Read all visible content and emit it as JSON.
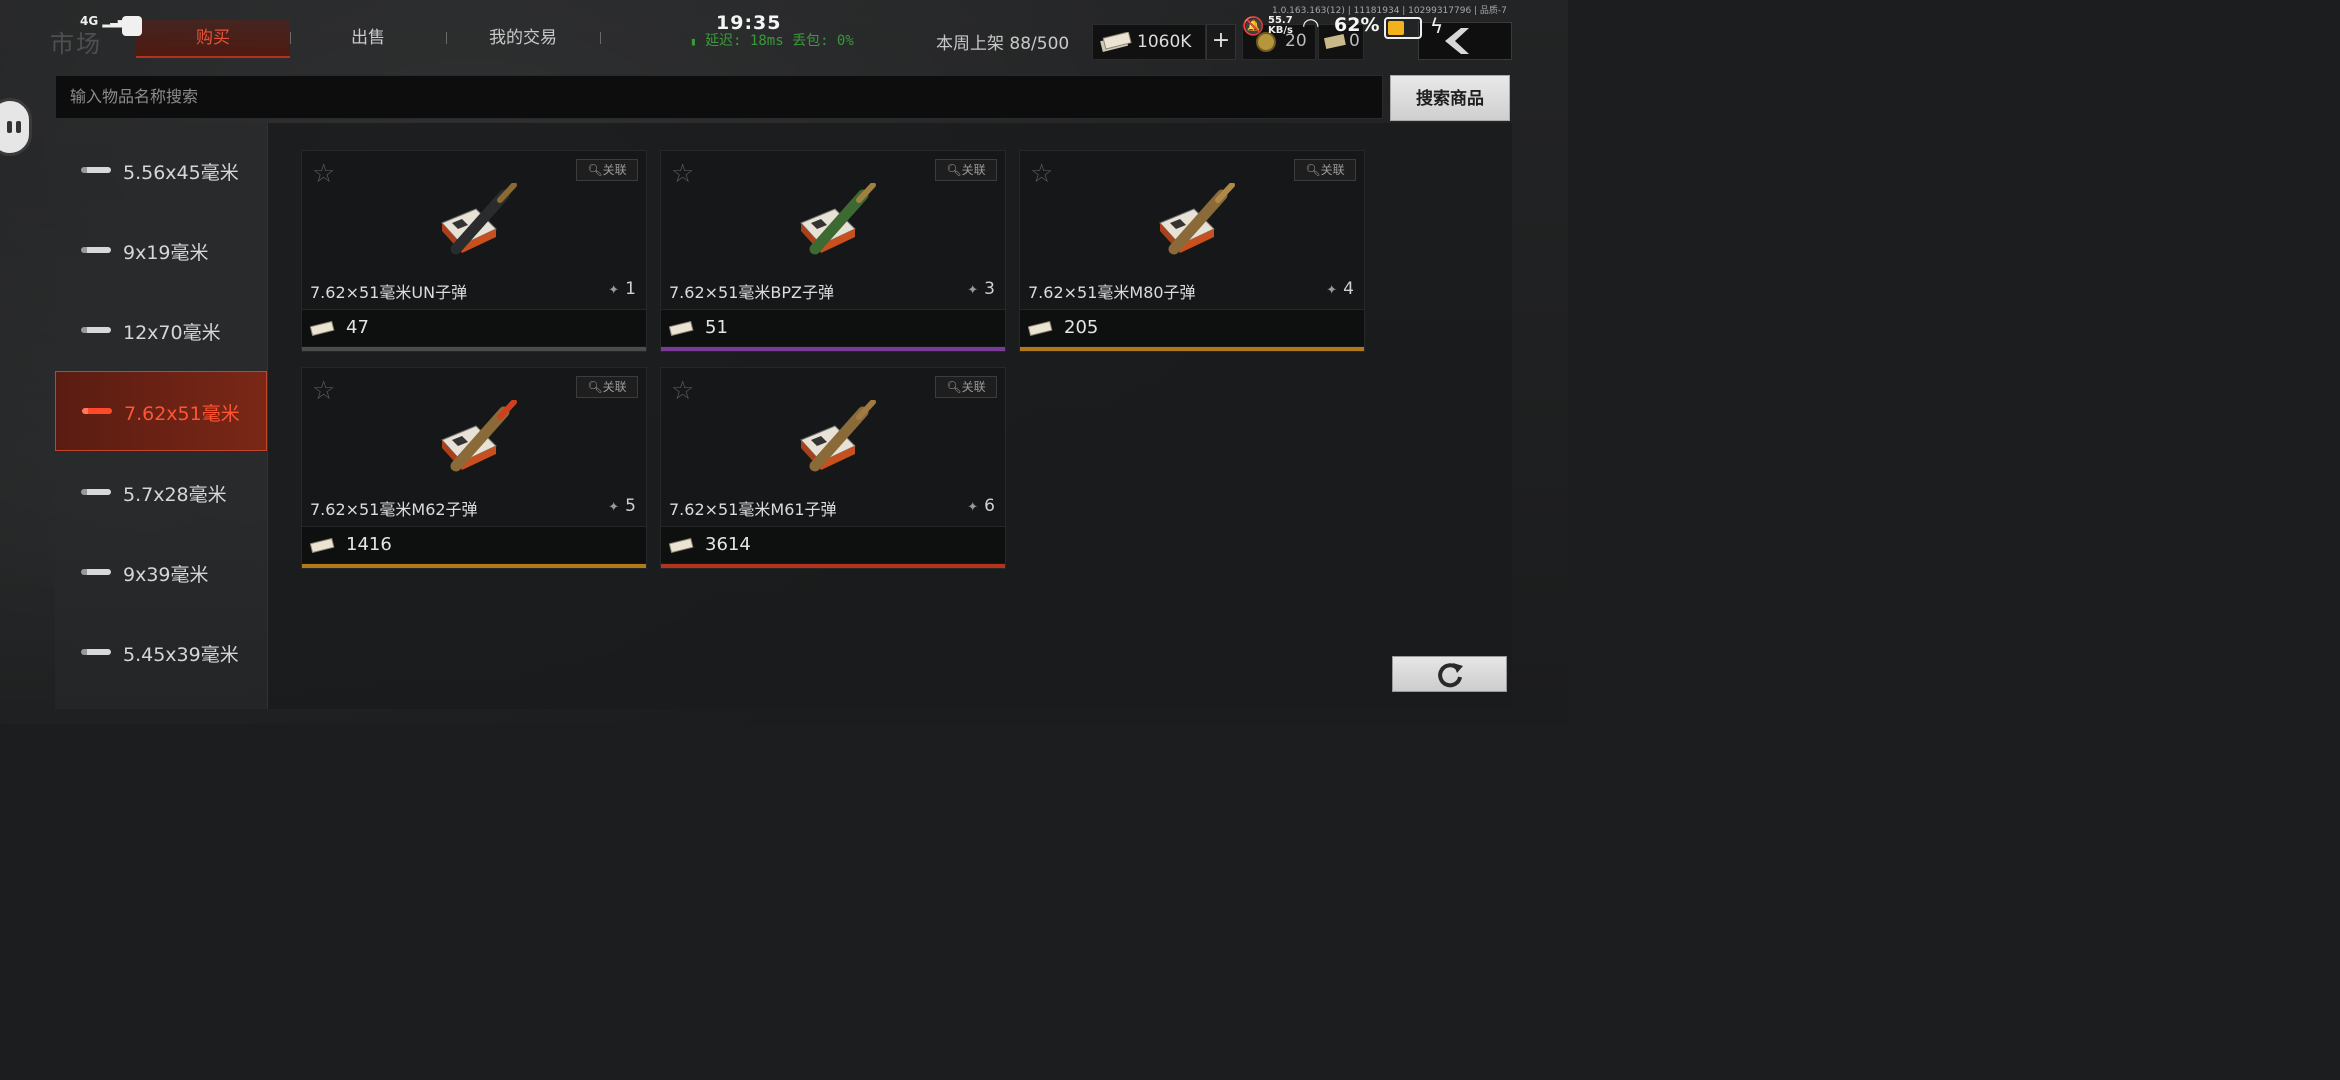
{
  "header": {
    "market_title": "市场",
    "tabs": [
      "购买",
      "出售",
      "我的交易"
    ],
    "latency": "延迟: 18ms  丢包: 0%",
    "weekly_listing": "本周上架  88/500",
    "money": "1060K",
    "plus": "+",
    "coins": "20",
    "tickets": "0"
  },
  "status_bar": {
    "network": "4G",
    "time": "19:35",
    "speed": "55.7\nKB/s",
    "battery": "62%",
    "battery_level": 0.62,
    "version": "1.0.163.163(12) | 11181934 | 10299317796 | 品质-7"
  },
  "search": {
    "placeholder": "输入物品名称搜索",
    "button": "搜索商品"
  },
  "categories": [
    {
      "label": "5.56x45毫米",
      "active": false
    },
    {
      "label": "9x19毫米",
      "active": false
    },
    {
      "label": "12x70毫米",
      "active": false
    },
    {
      "label": "7.62x51毫米",
      "active": true
    },
    {
      "label": "5.7x28毫米",
      "active": false
    },
    {
      "label": "9x39毫米",
      "active": false
    },
    {
      "label": "5.45x39毫米",
      "active": false
    }
  ],
  "items": [
    {
      "name": "7.62×51毫米UN子弹",
      "count": "1",
      "price": "47",
      "link": "关联",
      "rarity_color": "#4a4d4c",
      "bullet_color": "#2a2b2d",
      "tip_color": "#8a6a30"
    },
    {
      "name": "7.62×51毫米BPZ子弹",
      "count": "3",
      "price": "51",
      "link": "关联",
      "rarity_color": "#7a3a9a",
      "bullet_color": "#3d6a32",
      "tip_color": "#a08040"
    },
    {
      "name": "7.62×51毫米M80子弹",
      "count": "4",
      "price": "205",
      "link": "关联",
      "rarity_color": "#b07a1c",
      "bullet_color": "#8a6a38",
      "tip_color": "#b0884a"
    },
    {
      "name": "7.62×51毫米M62子弹",
      "count": "5",
      "price": "1416",
      "link": "关联",
      "rarity_color": "#b07a1c",
      "bullet_color": "#8a6a38",
      "tip_color": "#d04020"
    },
    {
      "name": "7.62×51毫米M61子弹",
      "count": "6",
      "price": "3614",
      "link": "关联",
      "rarity_color": "#b2341d",
      "bullet_color": "#8a6a38",
      "tip_color": "#a07a42"
    }
  ]
}
